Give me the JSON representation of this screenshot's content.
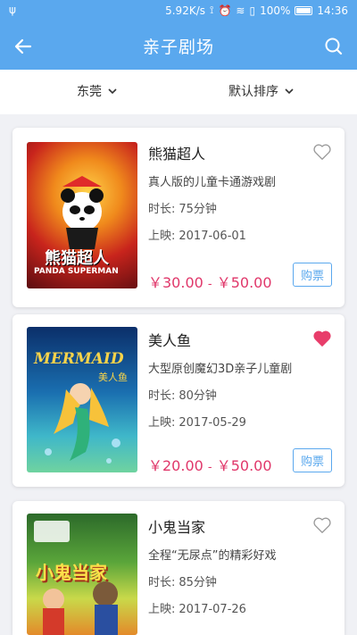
{
  "status_bar": {
    "net_speed": "5.92K/s",
    "battery": "100%",
    "time": "14:36"
  },
  "nav": {
    "title": "亲子剧场"
  },
  "filters": {
    "city": "东莞",
    "sort": "默认排序"
  },
  "labels": {
    "duration": "时长:",
    "release": "上映:",
    "buy": "购票",
    "price_sep": "-"
  },
  "shows": [
    {
      "name": "熊猫超人",
      "description": "真人版的儿童卡通游戏剧",
      "duration": "75分钟",
      "release_date": "2017-06-01",
      "price_min": "￥30.00",
      "price_max": "￥50.00",
      "favorited": false,
      "poster_text": "熊猫超人",
      "poster_subtext": "PANDA SUPERMAN"
    },
    {
      "name": "美人鱼",
      "description": "大型原创魔幻3D亲子儿童剧",
      "duration": "80分钟",
      "release_date": "2017-05-29",
      "price_min": "￥20.00",
      "price_max": "￥50.00",
      "favorited": true,
      "poster_text": "MERMAID",
      "poster_subtext": "美人鱼"
    },
    {
      "name": "小鬼当家",
      "description": "全程“无尿点”的精彩好戏",
      "duration": "85分钟",
      "release_date": "2017-07-26",
      "favorited": false,
      "poster_text": "小鬼当家"
    }
  ],
  "colors": {
    "primary": "#5aa8ee",
    "price": "#e0376a",
    "heart_active": "#e83d6a"
  }
}
